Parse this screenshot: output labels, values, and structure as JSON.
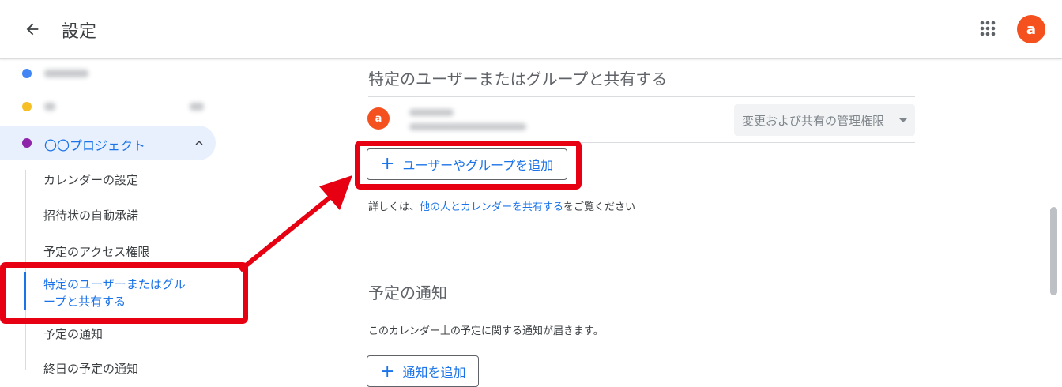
{
  "header": {
    "title": "設定",
    "avatar_letter": "a",
    "icons": {
      "back": "arrow-left-icon",
      "apps": "apps-grid-icon"
    }
  },
  "sidebar": {
    "calendars": [
      {
        "label": "",
        "color": "#4285f4"
      },
      {
        "label": "",
        "color": "#f6bf26"
      },
      {
        "label": "〇〇プロジェクト",
        "color": "#8e24aa",
        "expanded": true
      }
    ],
    "sub_items": [
      {
        "label": "カレンダーの設定",
        "active": false
      },
      {
        "label": "招待状の自動承諾",
        "active": false
      },
      {
        "label": "予定のアクセス権限",
        "active": false
      },
      {
        "label": "特定のユーザーまたはグル\nープと共有する",
        "active": true
      },
      {
        "label": "予定の通知",
        "active": false
      },
      {
        "label": "終日の予定の通知",
        "active": false
      }
    ]
  },
  "main": {
    "share_section": {
      "title": "特定のユーザーまたはグループと共有する",
      "user": {
        "avatar_letter": "a",
        "permission": "変更および共有の管理権限"
      },
      "add_button": "ユーザーやグループを追加",
      "info_prefix": "詳しくは、",
      "info_link": "他の人とカレンダーを共有する",
      "info_suffix": "をご覧ください"
    },
    "notify_section": {
      "title": "予定の通知",
      "description": "このカレンダー上の予定に関する通知が届きます。",
      "add_button": "通知を追加"
    }
  },
  "colors": {
    "accent": "#1a73e8",
    "avatar": "#f4511e",
    "highlight": "#e60012",
    "active_bg": "#e8f0fe"
  }
}
